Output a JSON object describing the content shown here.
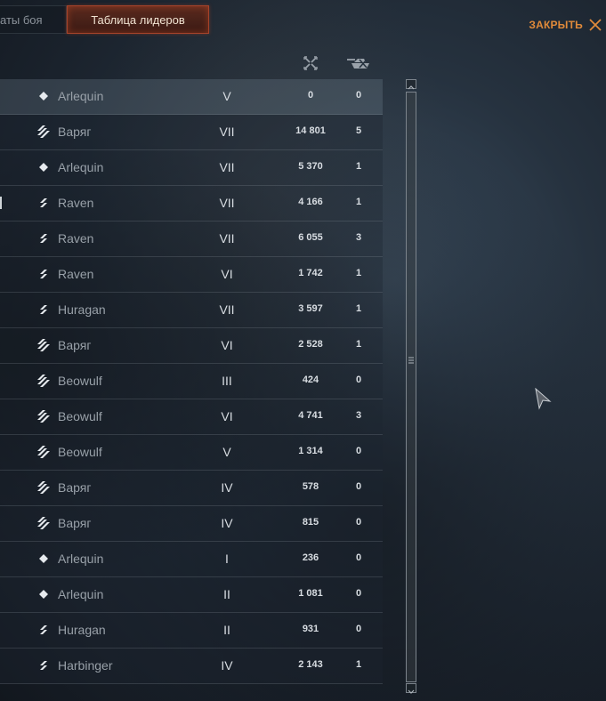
{
  "tabs": {
    "inactive_label": "аты боя",
    "active_label": "Таблица лидеров"
  },
  "close": {
    "label": "ЗАКРЫТЬ"
  },
  "columns": {
    "damage_icon": "crossed-swords-icon",
    "kills_icon": "destroyed-tank-icon"
  },
  "rows": [
    {
      "class_icon": "light-diamond-icon",
      "name": "Arlequin",
      "tier": "V",
      "damage": "0",
      "kills": "0"
    },
    {
      "class_icon": "heavy-stripes-icon",
      "name": "Варяг",
      "tier": "VII",
      "damage": "14 801",
      "kills": "5"
    },
    {
      "class_icon": "light-diamond-icon",
      "name": "Arlequin",
      "tier": "VII",
      "damage": "5 370",
      "kills": "1"
    },
    {
      "class_icon": "medium-stripes-icon",
      "name": "Raven",
      "tier": "VII",
      "damage": "4 166",
      "kills": "1"
    },
    {
      "class_icon": "medium-stripes-icon",
      "name": "Raven",
      "tier": "VII",
      "damage": "6 055",
      "kills": "3"
    },
    {
      "class_icon": "medium-stripes-icon",
      "name": "Raven",
      "tier": "VI",
      "damage": "1 742",
      "kills": "1"
    },
    {
      "class_icon": "medium-stripes-icon",
      "name": "Huragan",
      "tier": "VII",
      "damage": "3 597",
      "kills": "1"
    },
    {
      "class_icon": "heavy-stripes-icon",
      "name": "Варяг",
      "tier": "VI",
      "damage": "2 528",
      "kills": "1"
    },
    {
      "class_icon": "heavy-stripes-icon",
      "name": "Beowulf",
      "tier": "III",
      "damage": "424",
      "kills": "0"
    },
    {
      "class_icon": "heavy-stripes-icon",
      "name": "Beowulf",
      "tier": "VI",
      "damage": "4 741",
      "kills": "3"
    },
    {
      "class_icon": "heavy-stripes-icon",
      "name": "Beowulf",
      "tier": "V",
      "damage": "1 314",
      "kills": "0"
    },
    {
      "class_icon": "heavy-stripes-icon",
      "name": "Варяг",
      "tier": "IV",
      "damage": "578",
      "kills": "0"
    },
    {
      "class_icon": "heavy-stripes-icon",
      "name": "Варяг",
      "tier": "IV",
      "damage": "815",
      "kills": "0"
    },
    {
      "class_icon": "light-diamond-icon",
      "name": "Arlequin",
      "tier": "I",
      "damage": "236",
      "kills": "0"
    },
    {
      "class_icon": "light-diamond-icon",
      "name": "Arlequin",
      "tier": "II",
      "damage": "1 081",
      "kills": "0"
    },
    {
      "class_icon": "medium-stripes-icon",
      "name": "Huragan",
      "tier": "II",
      "damage": "931",
      "kills": "0"
    },
    {
      "class_icon": "medium-stripes-icon",
      "name": "Harbinger",
      "tier": "IV",
      "damage": "2 143",
      "kills": "1"
    }
  ],
  "scrollbar": {
    "up_icon": "chevron-up-icon",
    "down_icon": "chevron-down-icon",
    "grip_icon": "grip-lines-icon"
  },
  "colors": {
    "accent": "#e08a3a",
    "active_tab_border": "#a5432a",
    "text_primary": "#d8dde2",
    "text_muted": "#98a0a8"
  }
}
